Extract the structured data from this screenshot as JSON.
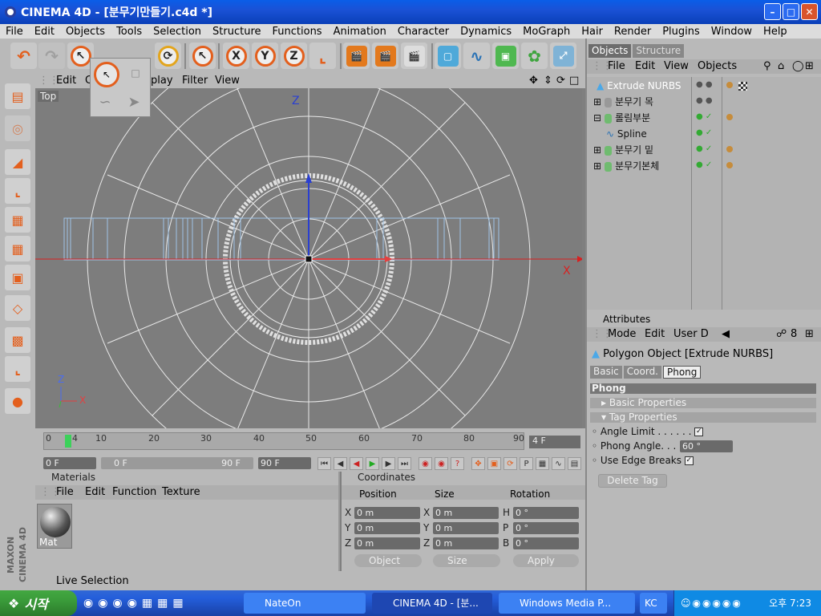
{
  "window": {
    "title": "CINEMA 4D - [분무기만들기.c4d *]"
  },
  "menu": [
    "File",
    "Edit",
    "Objects",
    "Tools",
    "Selection",
    "Structure",
    "Functions",
    "Animation",
    "Character",
    "Dynamics",
    "MoGraph",
    "Hair",
    "Render",
    "Plugins",
    "Window",
    "Help"
  ],
  "toolbar": {
    "x": "X",
    "y": "Y",
    "z": "Z"
  },
  "viewport": {
    "menu": [
      "Edit",
      "C",
      "play",
      "Filter",
      "View"
    ],
    "label": "Top",
    "axis_x": "X",
    "axis_z": "Z"
  },
  "timeline": {
    "ticks": [
      "0",
      "4",
      "10",
      "20",
      "30",
      "40",
      "50",
      "60",
      "70",
      "80",
      "90"
    ],
    "current_frame": "4 F",
    "start_field": "0 F",
    "range_start": "0 F",
    "range_end": "90 F",
    "end_field": "90 F"
  },
  "materials": {
    "title": "Materials",
    "menu": [
      "File",
      "Edit",
      "Function",
      "Texture"
    ],
    "item": "Mat"
  },
  "coordinates": {
    "title": "Coordinates",
    "headers": [
      "Position",
      "Size",
      "Rotation"
    ],
    "rows": [
      {
        "l1": "X",
        "v1": "0 m",
        "l2": "X",
        "v2": "0 m",
        "l3": "H",
        "v3": "0 °"
      },
      {
        "l1": "Y",
        "v1": "0 m",
        "l2": "Y",
        "v2": "0 m",
        "l3": "P",
        "v3": "0 °"
      },
      {
        "l1": "Z",
        "v1": "0 m",
        "l2": "Z",
        "v2": "0 m",
        "l3": "B",
        "v3": "0 °"
      }
    ],
    "mode": "Object",
    "size_mode": "Size",
    "apply": "Apply"
  },
  "status": "Live Selection",
  "objects": {
    "tabs": [
      "Objects",
      "Structure"
    ],
    "menu": [
      "File",
      "Edit",
      "View",
      "Objects"
    ],
    "items": [
      "Extrude NURBS",
      "분무기 목",
      "롤림부분",
      "Spline",
      "분무기 밑",
      "분무기본체"
    ]
  },
  "attributes": {
    "title": "Attributes",
    "menu": [
      "Mode",
      "Edit",
      "User D"
    ],
    "object_title": "Polygon Object [Extrude NURBS]",
    "tabs": [
      "Basic",
      "Coord.",
      "Phong"
    ],
    "section": "Phong",
    "groups": [
      "Basic Properties",
      "Tag Properties"
    ],
    "angle_limit": "Angle Limit . . . . . .",
    "phong_angle": "Phong Angle. . . . .",
    "phong_value": "60 °",
    "edge_breaks": "Use Edge Breaks",
    "delete_tag": "Delete Tag"
  },
  "taskbar": {
    "start": "시작",
    "tasks": [
      "NateOn",
      "CINEMA 4D - [분...",
      "Windows Media P...",
      "KC"
    ],
    "time": "오후 7:23"
  },
  "branding": "MAXON CINEMA 4D"
}
